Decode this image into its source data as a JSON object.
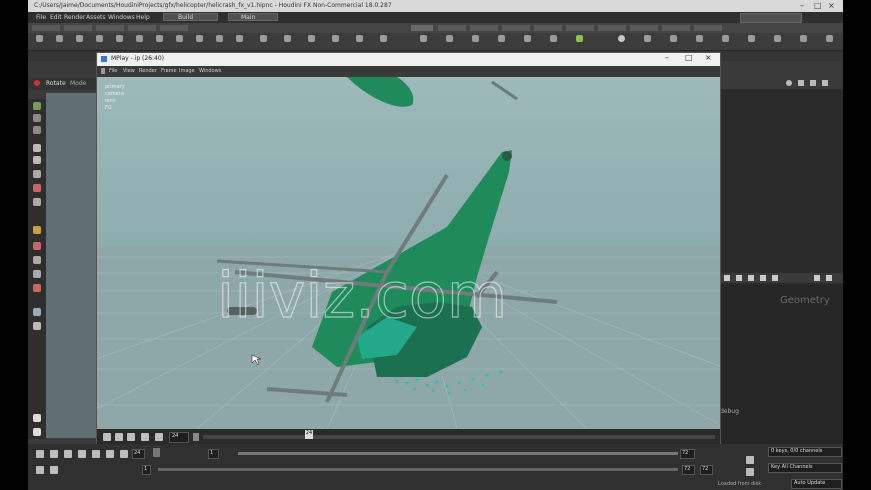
{
  "app": {
    "title": "C:/Users/Jaime/Documents/HoudiniProjects/gfx/helicopter/helicrash_fx_v1.hipnc - Houdini FX Non-Commercial 18.0.287",
    "menu": [
      "File",
      "Edit",
      "Render",
      "Assets",
      "Windows",
      "Help"
    ],
    "build_label": "Build",
    "desk_label": "Main"
  },
  "pane": {
    "tabs": [
      "Rotate",
      "Mode"
    ]
  },
  "mplay": {
    "title": "MPlay - ip (26:40)",
    "menu": [
      "File",
      "View",
      "Render",
      "Frame",
      "Image",
      "Windows"
    ],
    "overlay": [
      "primary",
      "camera",
      "lens",
      "FG"
    ],
    "current_frame": "24",
    "timeline_marker": "24"
  },
  "viewport": {
    "watermark": "iiiviz.com"
  },
  "network": {
    "context_label": "Geometry",
    "node_label": "debug"
  },
  "playbar": {
    "fps_field": "24",
    "start_field": "1",
    "range_start": "1",
    "end_frame": "72",
    "end_frame_2": "72",
    "keys_menu": "0 keys, 0/0 channels",
    "key_all_label": "Key All Channels",
    "auto_update": "Auto Update",
    "status_msg": "Loaded from disk"
  },
  "colors": {
    "helicopter": "#1f8a5a",
    "sky": "#8fb1b3",
    "floor": "#8aa5a5"
  }
}
